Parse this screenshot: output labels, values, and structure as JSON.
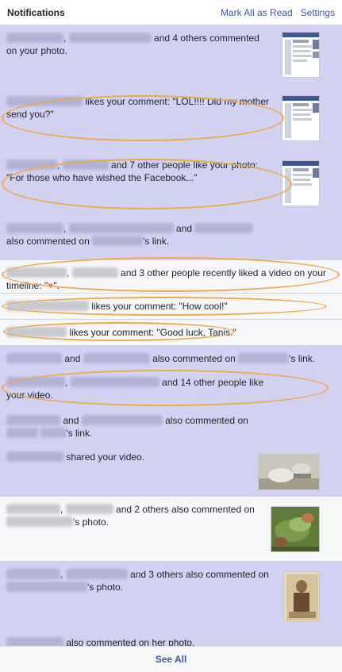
{
  "header": {
    "title": "Notifications",
    "mark_all_read": "Mark All as Read",
    "separator": "·",
    "settings": "Settings"
  },
  "notifications": [
    {
      "t1": ",",
      "t2": "and 4 others commented",
      "t3": "on your photo."
    },
    {
      "t1": "likes your comment: \"LOL!!!! Did my mother",
      "t2": "send you?\""
    },
    {
      "t1": ",",
      "t2": "and 7 other people like your photo:",
      "t3": "\"For those who have wished the Facebook...\""
    },
    {
      "t1": ",",
      "t2": "and",
      "t3": "also",
      "t4": "commented on",
      "t5": "'s link."
    },
    {
      "t1": ",",
      "t2": "and 3 other people recently liked a video on",
      "t3": "your timeline: \"",
      "heart": "♥",
      "t4": "\"."
    },
    {
      "t1": "likes your comment: \"How cool!\""
    },
    {
      "t1": "likes your comment: \"Good luck, Tanis.\""
    },
    {
      "t1": "and",
      "t2": "also commented on",
      "t3": "'s link."
    },
    {
      "t1": ",",
      "t2": "and 14 other people like your",
      "t3": "video."
    },
    {
      "t1": "and",
      "t2": "also commented on",
      "t3": "'s link."
    },
    {
      "t1": "shared your video."
    },
    {
      "t1": ",",
      "t2": "and 2 others also commented",
      "t3": "on",
      "t4": "'s photo."
    },
    {
      "t1": ",",
      "t2": "and 3 others also commented",
      "t3": "on",
      "t4": "'s photo."
    },
    {
      "t1": "also commented on her photo."
    }
  ],
  "footer": {
    "see_all": "See All"
  }
}
